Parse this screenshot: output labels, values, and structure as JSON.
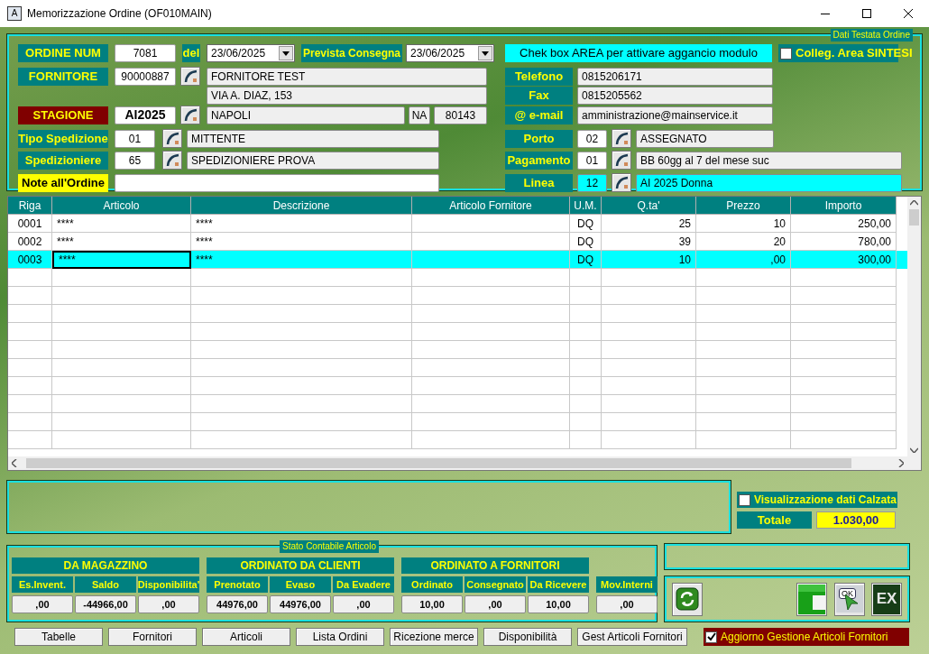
{
  "window": {
    "icon_letter": "A",
    "title": "Memorizzazione Ordine (OF010MAIN)"
  },
  "header": {
    "legend": "Dati Testata Ordine",
    "ordine": {
      "kind": "standard",
      "label": "ORDINE NUM",
      "value": "7081"
    },
    "del": {
      "kind": "standard",
      "label": "del",
      "value": "23/06/2025"
    },
    "prevista": {
      "kind": "standard",
      "label": "Prevista Consegna",
      "value": "23/06/2025"
    },
    "fornitore": {
      "kind": "standard",
      "label": "FORNITORE",
      "code": "90000887",
      "name": "FORNITORE TEST",
      "address": "VIA A. DIAZ, 153"
    },
    "stagione": {
      "kind": "alert",
      "label": "STAGIONE",
      "code": "AI2025",
      "city": "NAPOLI",
      "province": "NA",
      "zip": "80143"
    },
    "tipo_spedizione": {
      "kind": "standard",
      "label": "Tipo Spedizione",
      "code": "01",
      "description": "MITTENTE"
    },
    "spedizioniere": {
      "kind": "standard",
      "label": "Spedizioniere",
      "code": "65",
      "description": "SPEDIZIONIERE PROVA"
    },
    "note": {
      "kind": "note",
      "label": "Note all'Ordine"
    },
    "area_notice": "Chek box AREA per attivare aggancio modulo",
    "colleg": {
      "label": "Colleg. Area SINTESI",
      "checked": false
    },
    "telefono": {
      "kind": "standard",
      "label": "Telefono",
      "value": "0815206171"
    },
    "fax": {
      "kind": "standard",
      "label": "Fax",
      "value": "0815205562"
    },
    "email": {
      "kind": "standard",
      "label": "@ e-mail",
      "value": "amministrazione@mainservice.it"
    },
    "porto": {
      "kind": "standard",
      "label": "Porto",
      "code": "02",
      "description": "ASSEGNATO",
      "highlighted": false
    },
    "pagamento": {
      "kind": "standard",
      "label": "Pagamento",
      "code": "01",
      "description": "BB 60gg al 7 del mese suc",
      "highlighted": false
    },
    "linea": {
      "kind": "standard",
      "label": "Linea",
      "code": "12",
      "description": "AI 2025 Donna",
      "highlighted": true
    }
  },
  "table": {
    "columns": [
      "Riga",
      "Articolo",
      "Descrizione",
      "Articolo Fornitore",
      "U.M.",
      "Q.ta'",
      "Prezzo",
      "Importo"
    ],
    "rows": [
      {
        "selected": false,
        "cells": [
          {
            "text": "0001",
            "focused": false
          },
          {
            "text": "****",
            "focused": false
          },
          {
            "text": "****",
            "focused": false
          },
          {
            "focused": false
          },
          {
            "text": "DQ",
            "focused": false
          },
          {
            "text": "25",
            "focused": false
          },
          {
            "text": "10",
            "focused": false
          },
          {
            "text": "250,00",
            "focused": false
          }
        ]
      },
      {
        "selected": false,
        "cells": [
          {
            "text": "0002",
            "focused": false
          },
          {
            "text": "****",
            "focused": false
          },
          {
            "text": "****",
            "focused": false
          },
          {
            "focused": false
          },
          {
            "text": "DQ",
            "focused": false
          },
          {
            "text": "39",
            "focused": false
          },
          {
            "text": "20",
            "focused": false
          },
          {
            "text": "780,00",
            "focused": false
          }
        ]
      },
      {
        "selected": true,
        "cells": [
          {
            "text": "0003",
            "focused": false
          },
          {
            "text": "****",
            "focused": true
          },
          {
            "text": "****",
            "focused": false
          },
          {
            "focused": false
          },
          {
            "text": "DQ",
            "focused": false
          },
          {
            "text": "10",
            "focused": false
          },
          {
            "text": ",00",
            "focused": false
          },
          {
            "text": "300,00",
            "focused": false
          }
        ]
      }
    ]
  },
  "calzata": {
    "label": "Visualizzazione dati Calzata",
    "checked": false
  },
  "totale": {
    "label": "Totale",
    "value": "1.030,00"
  },
  "stato": {
    "legend": "Stato Contabile Articolo",
    "groups": [
      {
        "title": "DA MAGAZZINO",
        "columns": [
          {
            "label": "Es.Invent.",
            "value": ",00"
          },
          {
            "label": "Saldo",
            "value": "-44966,00"
          },
          {
            "label": "Disponibilita'",
            "value": ",00"
          }
        ]
      },
      {
        "title": "ORDINATO DA CLIENTI",
        "columns": [
          {
            "label": "Prenotato",
            "value": "44976,00"
          },
          {
            "label": "Evaso",
            "value": "44976,00"
          },
          {
            "label": "Da Evadere",
            "value": ",00"
          }
        ]
      },
      {
        "title": "ORDINATO A FORNITORI",
        "columns": [
          {
            "label": "Ordinato",
            "value": "10,00"
          },
          {
            "label": "Consegnato",
            "value": ",00"
          },
          {
            "label": "Da Ricevere",
            "value": "10,00"
          }
        ]
      },
      {
        "columns": [
          {
            "label": "Mov.Interni",
            "value": ",00"
          }
        ]
      }
    ]
  },
  "actions": {
    "ok_icon_text": "OK",
    "ex_icon_text": "EX"
  },
  "buttons": [
    "Tabelle",
    "Fornitori",
    "Articoli",
    "Lista Ordini",
    "Ricezione merce",
    "Disponibilità",
    "Gest Articoli Fornitori"
  ],
  "aggiorno": {
    "label": "Aggiorno Gestione Articoli Fornitori",
    "checked": true
  }
}
